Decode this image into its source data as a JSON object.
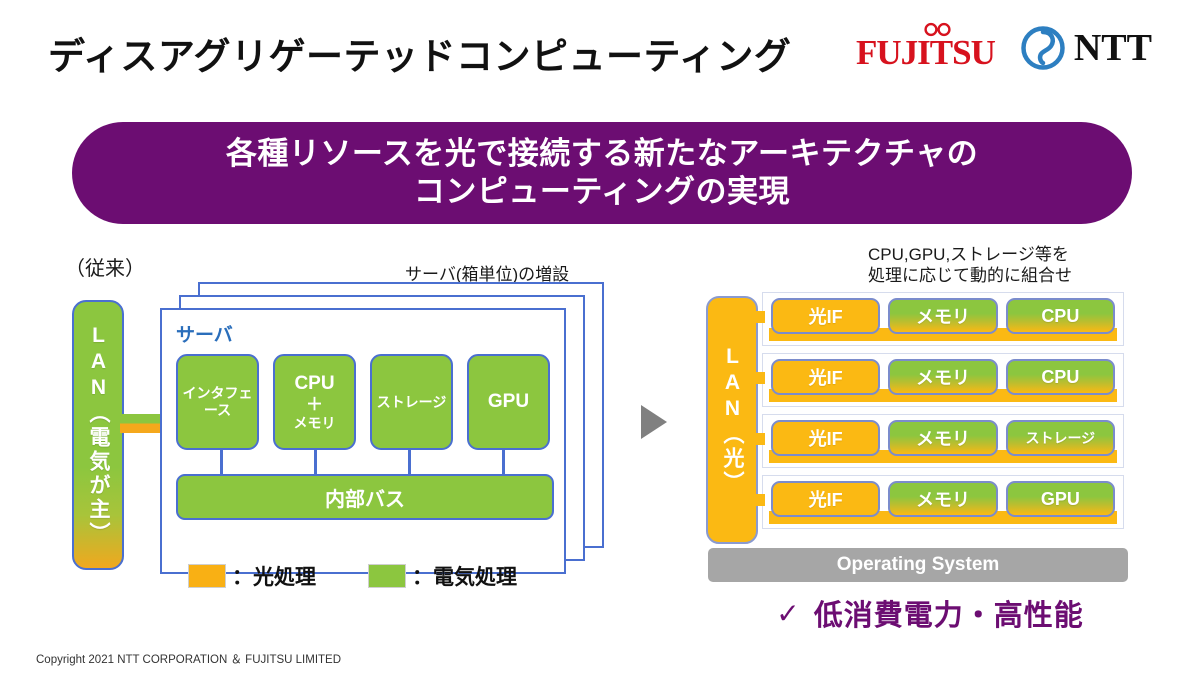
{
  "header": {
    "title": "ディスアグリゲーテッドコンピューティング",
    "fujitsu_logo_text": "FUJITSU",
    "ntt_logo_text": "NTT"
  },
  "banner": {
    "line1": "各種リソースを光で接続する新たなアーキテクチャの",
    "line2": "コンピューティングの実現"
  },
  "left": {
    "legacy_label": "（従来）",
    "scale_label": "サーバ(箱単位)の増設",
    "lan_label": "LAN（電気が主）",
    "server_label": "サーバ",
    "components": [
      {
        "line1": "インタフェース",
        "size": "small"
      },
      {
        "line1": "CPU",
        "line2": "＋",
        "line3": "メモリ",
        "size": "stack"
      },
      {
        "line1": "ストレージ",
        "size": "small"
      },
      {
        "line1": "GPU",
        "size": "normal"
      }
    ],
    "internal_bus": "内部バス",
    "legend": [
      {
        "swatch": "optical",
        "label": "：光処理",
        "color": "#f9b014"
      },
      {
        "swatch": "electrical",
        "label": "：電気処理",
        "color": "#8cc63f"
      }
    ]
  },
  "arrow_icon": "play-triangle-right",
  "right": {
    "dynamic_label_line1": "CPU,GPU,ストレージ等を",
    "dynamic_label_line2": "処理に応じて動的に組合せ",
    "lan_label": "LAN（光）",
    "slots": [
      {
        "modules": [
          {
            "label": "光IF",
            "kind": "optical"
          },
          {
            "label": "メモリ",
            "kind": "hybrid"
          },
          {
            "label": "CPU",
            "kind": "hybrid"
          }
        ]
      },
      {
        "modules": [
          {
            "label": "光IF",
            "kind": "optical"
          },
          {
            "label": "メモリ",
            "kind": "hybrid"
          },
          {
            "label": "CPU",
            "kind": "hybrid"
          }
        ]
      },
      {
        "modules": [
          {
            "label": "光IF",
            "kind": "optical"
          },
          {
            "label": "メモリ",
            "kind": "hybrid"
          },
          {
            "label": "ストレージ",
            "kind": "hybrid",
            "small": true
          }
        ]
      },
      {
        "modules": [
          {
            "label": "光IF",
            "kind": "optical"
          },
          {
            "label": "メモリ",
            "kind": "hybrid"
          },
          {
            "label": "GPU",
            "kind": "hybrid"
          }
        ]
      }
    ],
    "os_label": "Operating System",
    "benefit_check": "✓",
    "benefit_text": "低消費電力・高性能"
  },
  "footer": {
    "copyright": "Copyright 2021 NTT CORPORATION ＆ FUJITSU LIMITED"
  },
  "colors": {
    "banner_purple": "#6c0d72",
    "fujitsu_red": "#d7121e",
    "ntt_blue": "#2d7fc1",
    "electrical_green": "#8cc63f",
    "optical_orange": "#fbb913",
    "border_blue": "#4a6fd0",
    "os_gray": "#a6a6a6"
  }
}
